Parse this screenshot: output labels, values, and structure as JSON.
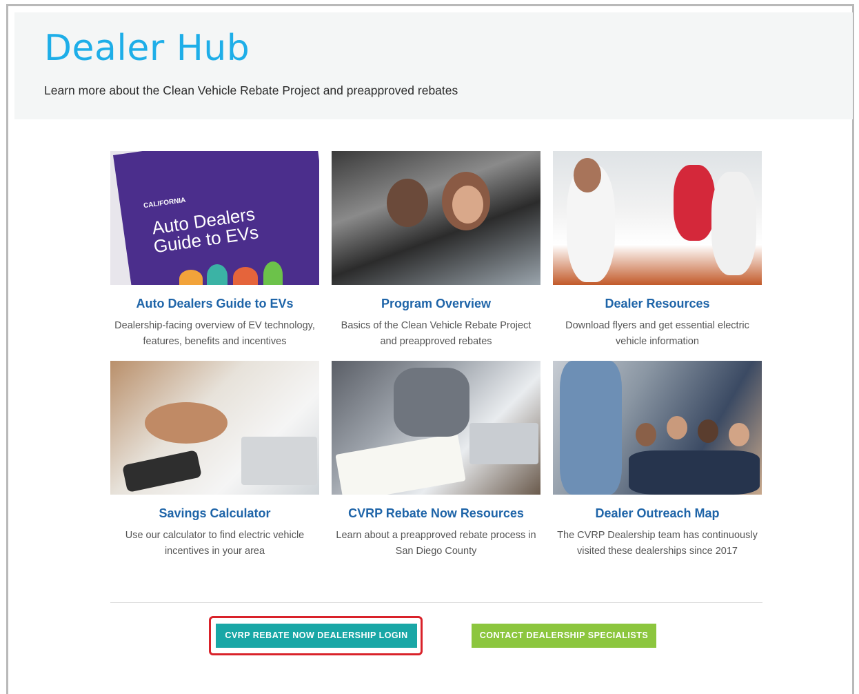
{
  "header": {
    "title": "Dealer Hub",
    "subtitle": "Learn more about the Clean Vehicle Rebate Project and preapproved rebates"
  },
  "cards": [
    {
      "title": "Auto Dealers Guide to EVs",
      "desc": "Dealership-facing overview of EV technology, features, benefits and incentives",
      "image_text_small": "CALIFORNIA",
      "image_text_big": "Auto Dealers Guide to EVs"
    },
    {
      "title": "Program Overview",
      "desc": "Basics of the Clean Vehicle Rebate Project and preapproved rebates"
    },
    {
      "title": "Dealer Resources",
      "desc": "Download flyers and get essential electric vehicle information"
    },
    {
      "title": "Savings Calculator",
      "desc": "Use our calculator to find electric vehicle incentives in your area"
    },
    {
      "title": "CVRP Rebate Now Resources",
      "desc": "Learn about a preapproved rebate process in San Diego County"
    },
    {
      "title": "Dealer Outreach Map",
      "desc": "The CVRP Dealership team has continuously visited these dealerships since 2017"
    }
  ],
  "buttons": {
    "login": "CVRP REBATE NOW DEALERSHIP LOGIN",
    "contact": "CONTACT DEALERSHIP SPECIALISTS"
  },
  "colors": {
    "title": "#1eaee8",
    "card_title": "#1e64a8",
    "login_button": "#19a7a6",
    "contact_button": "#8cc63e",
    "highlight_border": "#d9222a"
  }
}
